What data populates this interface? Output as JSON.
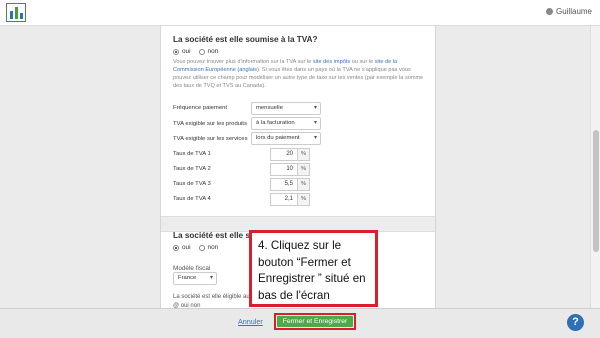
{
  "user": {
    "name": "Guillaume"
  },
  "tva_section": {
    "title": "La société est elle soumise à la TVA?",
    "radio_oui": "oui",
    "radio_non": "non",
    "info_parts": [
      "Vous pouvez trouver plus d'information sur la TVA sur le ",
      "site des impôts",
      " ou sur le ",
      "site de la Commission Européenne (anglais)",
      ". Si vous êtes dans un pays où la TVA ne s'applique pas vous pouvez utiliser ce champ pour modéliser un autre type de taxe sur les ventes (par exemple la somme des taux de TVQ et TVS au Canada)."
    ],
    "frequence_label": "Fréquence paiement",
    "frequence_value": "mensuelle",
    "produits_label": "TVA exigible sur les produits",
    "produits_value": "à la facturation",
    "services_label": "TVA exigible sur les services",
    "services_value": "lors du paiement",
    "rates": [
      {
        "label": "Taux de TVA 1",
        "value": "20",
        "unit": "%"
      },
      {
        "label": "Taux de TVA 2",
        "value": "10",
        "unit": "%"
      },
      {
        "label": "Taux de TVA 3",
        "value": "5,5",
        "unit": "%"
      },
      {
        "label": "Taux de TVA 4",
        "value": "2,1",
        "unit": "%"
      }
    ]
  },
  "second_section": {
    "title_visible": "La société est elle soumi",
    "radio_oui": "oui",
    "radio_non": "non",
    "fiscal_label": "Modèle fiscal",
    "fiscal_value": "France",
    "eligible_text": "La société est elle éligible au",
    "eligible_text2": "@ oui    non"
  },
  "footer": {
    "cancel_label": "Annuler",
    "save_label": "Fermer et Enregistrer",
    "help_label": "?"
  },
  "callout": {
    "text": "4. Cliquez sur le bouton “Fermer et Enregistrer ” situé en bas de l'écran"
  },
  "colors": {
    "accent_green": "#4fa84a",
    "highlight_red": "#d8202c",
    "link_blue": "#3a73b8",
    "help_blue": "#2f6fb5"
  }
}
